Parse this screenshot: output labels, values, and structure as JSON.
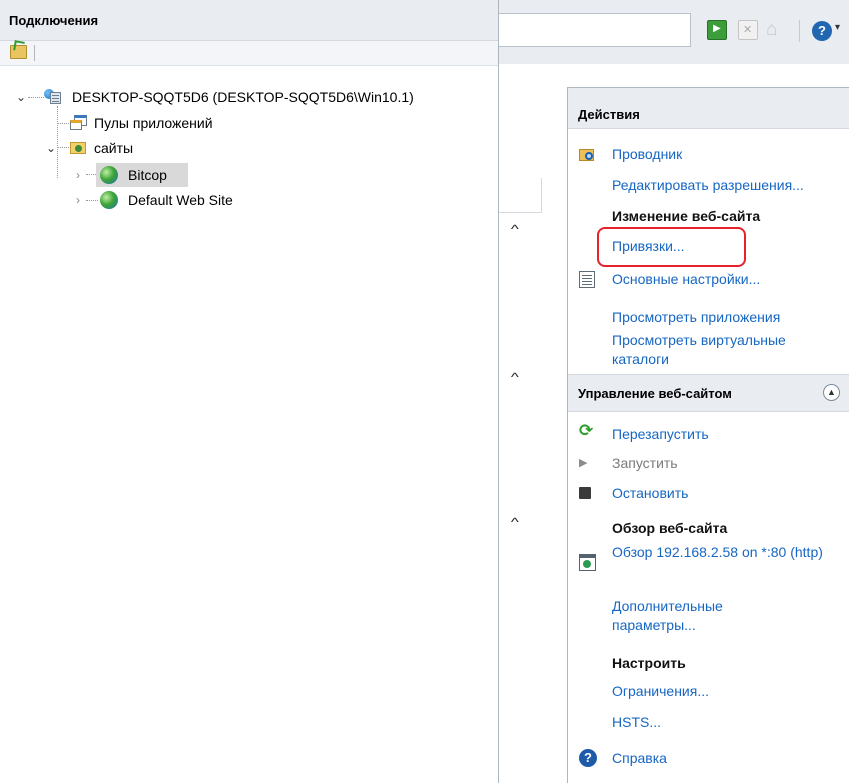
{
  "connections": {
    "title": "Подключения",
    "tree": {
      "server": "DESKTOP-SQQT5D6 (DESKTOP-SQQT5D6\\Win10.1)",
      "app_pools": "Пулы приложений",
      "sites": "сайты",
      "site_items": [
        "Bitcop",
        "Default Web Site"
      ]
    }
  },
  "actions": {
    "title": "Действия",
    "explorer": "Проводник",
    "edit_permissions": "Редактировать разрешения...",
    "edit_site": {
      "title": "Изменение веб-сайта",
      "bindings": "Привязки...",
      "basic_settings": "Основные настройки...",
      "view_apps": "Просмотреть приложения",
      "view_vdirs": "Просмотреть виртуальные каталоги"
    },
    "manage_site": {
      "title": "Управление веб-сайтом",
      "restart": "Перезапустить",
      "start": "Запустить",
      "stop": "Остановить",
      "browse_title": "Обзор веб-сайта",
      "browse_link": "Обзор 192.168.2.58 on *:80 (http)",
      "advanced": "Дополнительные параметры...",
      "configure_title": "Настроить",
      "limits": "Ограничения...",
      "hsts": "HSTS...",
      "help": "Справка"
    }
  },
  "colors": {
    "link": "#1666c4",
    "disabled": "#7a7a7a",
    "header_bg": "#e9edf2",
    "highlight_border": "#e8222a"
  }
}
